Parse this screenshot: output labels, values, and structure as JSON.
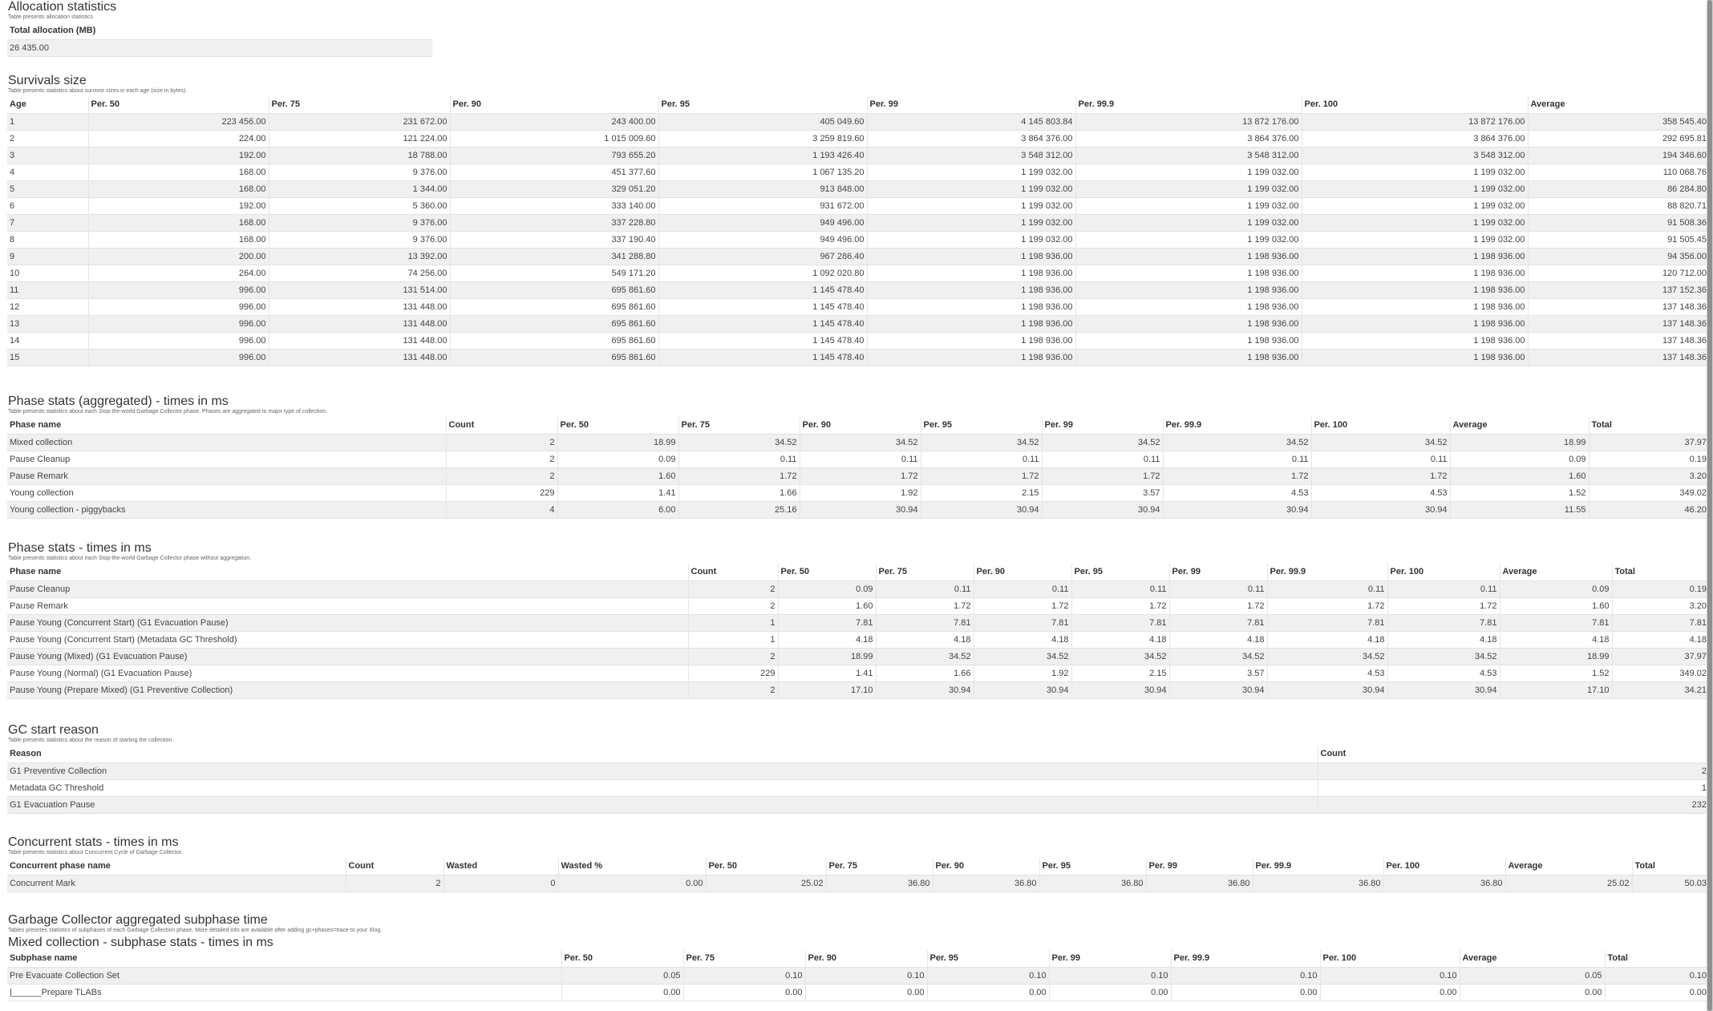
{
  "alloc": {
    "title": "Allocation statistics",
    "desc": "Table presents allocation statistics",
    "header": "Total allocation (MB)",
    "value": "26 435.00"
  },
  "surv": {
    "title": "Survivals size",
    "desc": "Table presents statistics about survivor sizes in each age (size in bytes).",
    "headers": [
      "Age",
      "Per. 50",
      "Per. 75",
      "Per. 90",
      "Per. 95",
      "Per. 99",
      "Per. 99.9",
      "Per. 100",
      "Average"
    ],
    "rows": [
      [
        "1",
        "223 456.00",
        "231 672.00",
        "243 400.00",
        "405 049.60",
        "4 145 803.84",
        "13 872 176.00",
        "13 872 176.00",
        "358 545.40"
      ],
      [
        "2",
        "224.00",
        "121 224.00",
        "1 015 009.60",
        "3 259 819.60",
        "3 864 376.00",
        "3 864 376.00",
        "3 864 376.00",
        "292 695.81"
      ],
      [
        "3",
        "192.00",
        "18 788.00",
        "793 655.20",
        "1 193 426.40",
        "3 548 312.00",
        "3 548 312.00",
        "3 548 312.00",
        "194 346.60"
      ],
      [
        "4",
        "168.00",
        "9 376.00",
        "451 377.60",
        "1 067 135.20",
        "1 199 032.00",
        "1 199 032.00",
        "1 199 032.00",
        "110 068.76"
      ],
      [
        "5",
        "168.00",
        "1 344.00",
        "329 051.20",
        "913 848.00",
        "1 199 032.00",
        "1 199 032.00",
        "1 199 032.00",
        "86 284.80"
      ],
      [
        "6",
        "192.00",
        "5 360.00",
        "333 140.00",
        "931 672.00",
        "1 199 032.00",
        "1 199 032.00",
        "1 199 032.00",
        "88 820.71"
      ],
      [
        "7",
        "168.00",
        "9 376.00",
        "337 228.80",
        "949 496.00",
        "1 199 032.00",
        "1 199 032.00",
        "1 199 032.00",
        "91 508.36"
      ],
      [
        "8",
        "168.00",
        "9 376.00",
        "337 190.40",
        "949 496.00",
        "1 199 032.00",
        "1 199 032.00",
        "1 199 032.00",
        "91 505.45"
      ],
      [
        "9",
        "200.00",
        "13 392.00",
        "341 288.80",
        "967 286.40",
        "1 198 936.00",
        "1 198 936.00",
        "1 198 936.00",
        "94 356.00"
      ],
      [
        "10",
        "264.00",
        "74 256.00",
        "549 171.20",
        "1 092 020.80",
        "1 198 936.00",
        "1 198 936.00",
        "1 198 936.00",
        "120 712.00"
      ],
      [
        "11",
        "996.00",
        "131 514.00",
        "695 861.60",
        "1 145 478.40",
        "1 198 936.00",
        "1 198 936.00",
        "1 198 936.00",
        "137 152.36"
      ],
      [
        "12",
        "996.00",
        "131 448.00",
        "695 861.60",
        "1 145 478.40",
        "1 198 936.00",
        "1 198 936.00",
        "1 198 936.00",
        "137 148.36"
      ],
      [
        "13",
        "996.00",
        "131 448.00",
        "695 861.60",
        "1 145 478.40",
        "1 198 936.00",
        "1 198 936.00",
        "1 198 936.00",
        "137 148.36"
      ],
      [
        "14",
        "996.00",
        "131 448.00",
        "695 861.60",
        "1 145 478.40",
        "1 198 936.00",
        "1 198 936.00",
        "1 198 936.00",
        "137 148.36"
      ],
      [
        "15",
        "996.00",
        "131 448.00",
        "695 861.60",
        "1 145 478.40",
        "1 198 936.00",
        "1 198 936.00",
        "1 198 936.00",
        "137 148.36"
      ]
    ]
  },
  "phaseAgg": {
    "title": "Phase stats (aggregated) - times in ms",
    "desc": "Table presents statistics about each Stop-the-world Garbage Collector phase. Phases are aggregated to major type of collection.",
    "headers": [
      "Phase name",
      "Count",
      "Per. 50",
      "Per. 75",
      "Per. 90",
      "Per. 95",
      "Per. 99",
      "Per. 99.9",
      "Per. 100",
      "Average",
      "Total"
    ],
    "rows": [
      [
        "Mixed collection",
        "2",
        "18.99",
        "34.52",
        "34.52",
        "34.52",
        "34.52",
        "34.52",
        "34.52",
        "18.99",
        "37.97"
      ],
      [
        "Pause Cleanup",
        "2",
        "0.09",
        "0.11",
        "0.11",
        "0.11",
        "0.11",
        "0.11",
        "0.11",
        "0.09",
        "0.19"
      ],
      [
        "Pause Remark",
        "2",
        "1.60",
        "1.72",
        "1.72",
        "1.72",
        "1.72",
        "1.72",
        "1.72",
        "1.60",
        "3.20"
      ],
      [
        "Young collection",
        "229",
        "1.41",
        "1.66",
        "1.92",
        "2.15",
        "3.57",
        "4.53",
        "4.53",
        "1.52",
        "349.02"
      ],
      [
        "Young collection - piggybacks",
        "4",
        "6.00",
        "25.16",
        "30.94",
        "30.94",
        "30.94",
        "30.94",
        "30.94",
        "11.55",
        "46.20"
      ]
    ]
  },
  "phase": {
    "title": "Phase stats - times in ms",
    "desc": "Table presents statistics about each Stop-the-world Garbage Collector phase without aggregation.",
    "headers": [
      "Phase name",
      "Count",
      "Per. 50",
      "Per. 75",
      "Per. 90",
      "Per. 95",
      "Per. 99",
      "Per. 99.9",
      "Per. 100",
      "Average",
      "Total"
    ],
    "rows": [
      [
        "Pause Cleanup",
        "2",
        "0.09",
        "0.11",
        "0.11",
        "0.11",
        "0.11",
        "0.11",
        "0.11",
        "0.09",
        "0.19"
      ],
      [
        "Pause Remark",
        "2",
        "1.60",
        "1.72",
        "1.72",
        "1.72",
        "1.72",
        "1.72",
        "1.72",
        "1.60",
        "3.20"
      ],
      [
        "Pause Young (Concurrent Start) (G1 Evacuation Pause)",
        "1",
        "7.81",
        "7.81",
        "7.81",
        "7.81",
        "7.81",
        "7.81",
        "7.81",
        "7.81",
        "7.81"
      ],
      [
        "Pause Young (Concurrent Start) (Metadata GC Threshold)",
        "1",
        "4.18",
        "4.18",
        "4.18",
        "4.18",
        "4.18",
        "4.18",
        "4.18",
        "4.18",
        "4.18"
      ],
      [
        "Pause Young (Mixed) (G1 Evacuation Pause)",
        "2",
        "18.99",
        "34.52",
        "34.52",
        "34.52",
        "34.52",
        "34.52",
        "34.52",
        "18.99",
        "37.97"
      ],
      [
        "Pause Young (Normal) (G1 Evacuation Pause)",
        "229",
        "1.41",
        "1.66",
        "1.92",
        "2.15",
        "3.57",
        "4.53",
        "4.53",
        "1.52",
        "349.02"
      ],
      [
        "Pause Young (Prepare Mixed) (G1 Preventive Collection)",
        "2",
        "17.10",
        "30.94",
        "30.94",
        "30.94",
        "30.94",
        "30.94",
        "30.94",
        "17.10",
        "34.21"
      ]
    ]
  },
  "gcReason": {
    "title": "GC start reason",
    "desc": "Table presents statistics about the reason of starting the collection.",
    "headers": [
      "Reason",
      "Count"
    ],
    "rows": [
      [
        "G1 Preventive Collection",
        "2"
      ],
      [
        "Metadata GC Threshold",
        "1"
      ],
      [
        "G1 Evacuation Pause",
        "232"
      ]
    ]
  },
  "concurrent": {
    "title": "Concurrent stats - times in ms",
    "desc": "Table presents statistics about Concurrent Cycle of Garbage Collector.",
    "headers": [
      "Concurrent phase name",
      "Count",
      "Wasted",
      "Wasted %",
      "Per. 50",
      "Per. 75",
      "Per. 90",
      "Per. 95",
      "Per. 99",
      "Per. 99.9",
      "Per. 100",
      "Average",
      "Total"
    ],
    "rows": [
      [
        "Concurrent Mark",
        "2",
        "0",
        "0.00",
        "25.02",
        "36.80",
        "36.80",
        "36.80",
        "36.80",
        "36.80",
        "36.80",
        "25.02",
        "50.03"
      ]
    ]
  },
  "subphase": {
    "title": "Garbage Collector aggregated subphase time",
    "desc": "Tables presntes statistics of subphases of each Garbage Collection phase. More detailed info are available after adding gc+phases=trace to your Xlog.",
    "subtitle": "Mixed collection - subphase stats - times in ms",
    "headers": [
      "Subphase name",
      "Per. 50",
      "Per. 75",
      "Per. 90",
      "Per. 95",
      "Per. 99",
      "Per. 99.9",
      "Per. 100",
      "Average",
      "Total"
    ],
    "rows": [
      [
        "Pre Evacuate Collection Set",
        "0.05",
        "0.10",
        "0.10",
        "0.10",
        "0.10",
        "0.10",
        "0.10",
        "0.05",
        "0.10"
      ],
      [
        "|______Prepare TLABs",
        "0.00",
        "0.00",
        "0.00",
        "0.00",
        "0.00",
        "0.00",
        "0.00",
        "0.00",
        "0.00"
      ]
    ]
  }
}
